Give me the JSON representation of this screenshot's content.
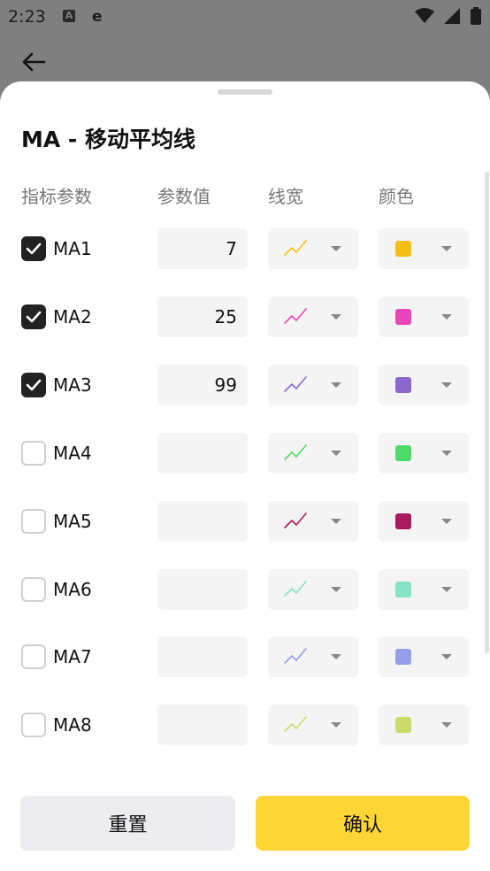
{
  "status_bar": {
    "time": "2:23",
    "app_a": "A",
    "app_e": "e"
  },
  "title": "MA - 移动平均线",
  "columns": {
    "param_name": "指标参数",
    "param_value": "参数值",
    "line_width": "线宽",
    "color": "颜色"
  },
  "indicators": [
    {
      "label": "MA1",
      "checked": true,
      "value": "7",
      "color": "#f5be15"
    },
    {
      "label": "MA2",
      "checked": true,
      "value": "25",
      "color": "#ec45b8"
    },
    {
      "label": "MA3",
      "checked": true,
      "value": "99",
      "color": "#8b67cc"
    },
    {
      "label": "MA4",
      "checked": false,
      "value": "",
      "color": "#4fd96a"
    },
    {
      "label": "MA5",
      "checked": false,
      "value": "",
      "color": "#a81c5e"
    },
    {
      "label": "MA6",
      "checked": false,
      "value": "",
      "color": "#86e3c6"
    },
    {
      "label": "MA7",
      "checked": false,
      "value": "",
      "color": "#94a0e6"
    },
    {
      "label": "MA8",
      "checked": false,
      "value": "",
      "color": "#cbdc6a"
    }
  ],
  "buttons": {
    "reset": "重置",
    "confirm": "确认"
  },
  "icons": {
    "back": "arrow-left-icon",
    "checkmark": "checkmark-icon",
    "line_width": "line-chart-icon",
    "caret": "caret-down-icon"
  }
}
